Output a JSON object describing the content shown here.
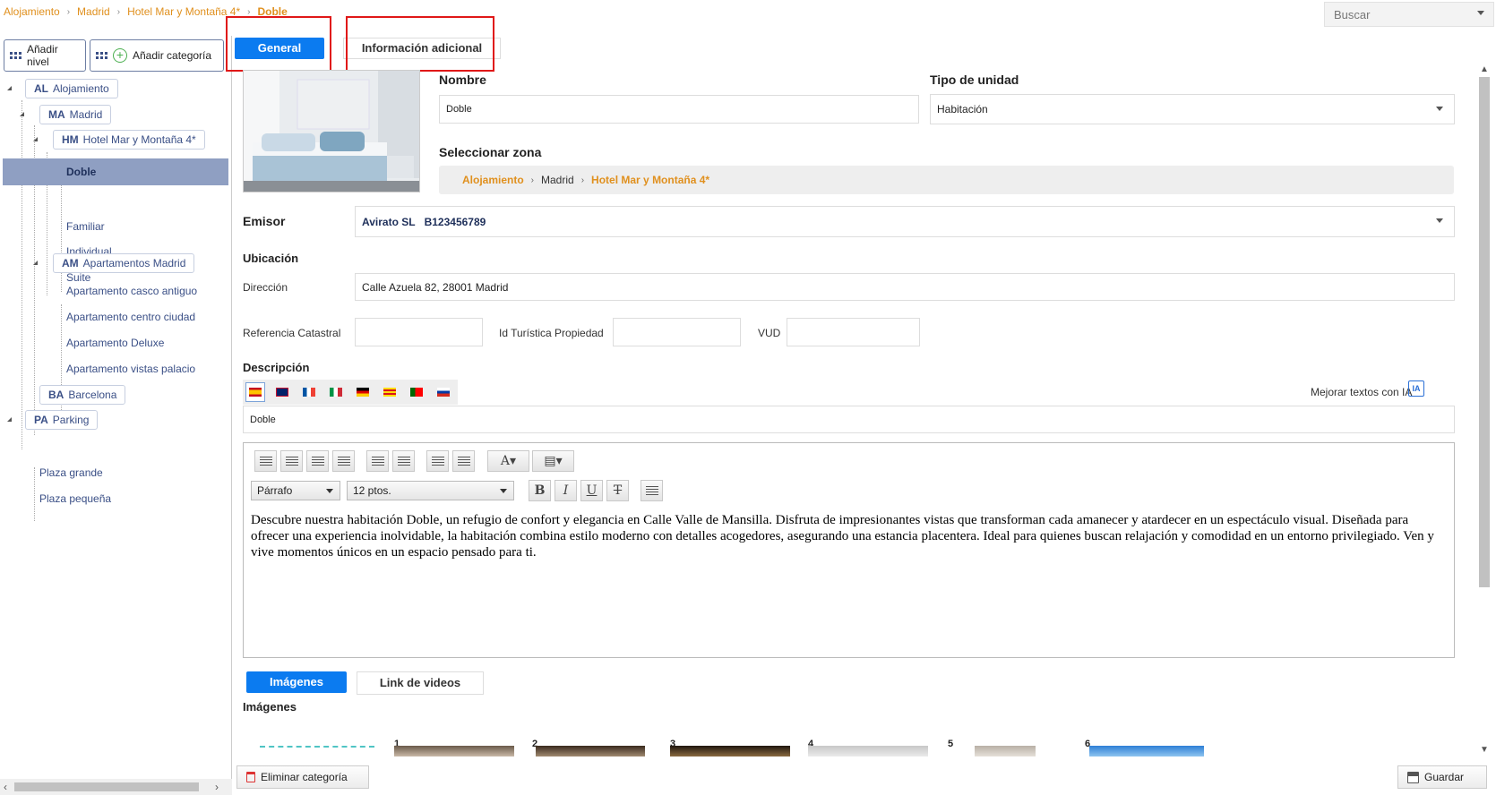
{
  "breadcrumb": [
    "Alojamiento",
    "Madrid",
    "Hotel Mar y Montaña 4*",
    "Doble"
  ],
  "search": {
    "label": "Buscar"
  },
  "sidebar": {
    "add_level": "Añadir nivel",
    "add_category": "Añadir categoría",
    "tree": {
      "al": {
        "code": "AL",
        "label": "Alojamiento"
      },
      "ma": {
        "code": "MA",
        "label": "Madrid"
      },
      "hm": {
        "code": "HM",
        "label": "Hotel Mar y Montaña 4*"
      },
      "hm_items": [
        "Doble",
        "Familiar",
        "Individual",
        "Suite"
      ],
      "am": {
        "code": "AM",
        "label": "Apartamentos Madrid"
      },
      "am_items": [
        "Apartamento casco antiguo",
        "Apartamento centro ciudad",
        "Apartamento Deluxe",
        "Apartamento vistas palacio"
      ],
      "ba": {
        "code": "BA",
        "label": "Barcelona"
      },
      "pa": {
        "code": "PA",
        "label": "Parking"
      },
      "pa_items": [
        "Plaza grande",
        "Plaza pequeña"
      ]
    }
  },
  "tabs": {
    "general": "General",
    "info": "Información adicional"
  },
  "form": {
    "nombre_label": "Nombre",
    "nombre_value": "Doble",
    "tipo_label": "Tipo de unidad",
    "tipo_value": "Habitación",
    "zona_label": "Seleccionar zona",
    "zona": [
      "Alojamiento",
      "Madrid",
      "Hotel Mar y Montaña 4*"
    ],
    "emisor_label": "Emisor",
    "emisor_name": "Avirato SL",
    "emisor_id": "B123456789",
    "ubicacion_label": "Ubicación",
    "direccion_label": "Dirección",
    "direccion_value": "Calle Azuela 82, 28001 Madrid",
    "ref_label": "Referencia Catastral",
    "idtur_label": "Id Turística Propiedad",
    "vud_label": "VUD",
    "descripcion_label": "Descripción",
    "mejorar_label": "Mejorar textos con IA",
    "desc_title": "Doble"
  },
  "editor": {
    "format": "Párrafo",
    "size": "12 ptos.",
    "text": "Descubre nuestra habitación Doble, un refugio de confort y elegancia en Calle Valle de Mansilla. Disfruta de impresionantes vistas que transforman cada amanecer y atardecer en un espectáculo visual. Diseñada para ofrecer una experiencia inolvidable, la habitación combina estilo moderno con detalles acogedores, asegurando una estancia placentera. Ideal para quienes buscan relajación y comodidad en un entorno privilegiado. Ven y vive momentos únicos en un espacio pensado para ti."
  },
  "media": {
    "tab_images": "Imágenes",
    "tab_videos": "Link de videos",
    "section": "Imágenes",
    "thumbs": [
      "1",
      "2",
      "3",
      "4",
      "5",
      "6"
    ]
  },
  "footer": {
    "delete": "Eliminar categoría",
    "save": "Guardar"
  },
  "colors": {
    "accent": "#0b7bf0",
    "orange": "#e0901e",
    "navy": "#3a4f86",
    "highlight": "#e01818"
  }
}
